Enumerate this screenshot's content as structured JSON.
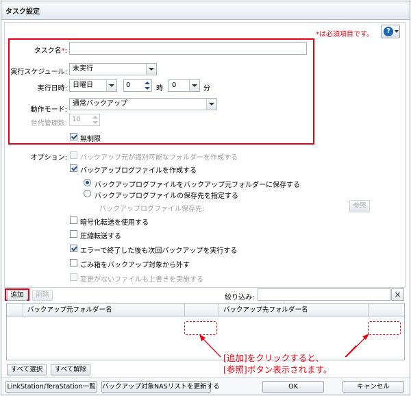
{
  "window": {
    "title": "タスク設定"
  },
  "header": {
    "required_note": "*は必須項目です。",
    "help_glyph": "?"
  },
  "form": {
    "task_name_label": "タスク名",
    "required_mark": "*",
    "colon": ":",
    "task_name_value": "",
    "schedule_label": "実行スケジュール:",
    "schedule_value": "未実行",
    "datetime_label": "実行日時:",
    "day_value": "日曜日",
    "hour_value": "0",
    "hour_unit": "時",
    "minute_value": "0",
    "minute_unit": "分",
    "mode_label": "動作モード:",
    "mode_value": "通常バックアップ",
    "generations_label": "世代管理数:",
    "generations_value": "10",
    "unlimited_label": "無制限"
  },
  "options": {
    "label": "オプション:",
    "identifiable_folder": "バックアップ元が識別可能なフォルダーを作成する",
    "create_log": "バックアップログファイルを作成する",
    "save_log_source": "バックアップログファイルをバックアップ元フォルダーに保存する",
    "specify_log_dest": "バックアップログファイルの保存先を指定する",
    "log_dest_label": "バックアップログファイル保存先:",
    "browse": "参照",
    "encrypt": "暗号化転送を使用する",
    "compress": "圧縮転送する",
    "retry_after_error": "エラーで終了した後も次回バックアップを実行する",
    "exclude_trash": "ごみ箱をバックアップ対象から外す",
    "overwrite_unchanged": "変更がないファイルも上書きを実施する"
  },
  "list": {
    "add": "追加",
    "delete": "削除",
    "filter_label": "絞り込み:",
    "filter_value": "",
    "clear_glyph": "×",
    "col_source": "バックアップ元フォルダー名",
    "col_dest": "バックアップ先フォルダー名",
    "select_all": "すべて選択",
    "deselect_all": "すべて解除"
  },
  "annotation": {
    "line1": "[追加]をクリックすると、",
    "line2": "[参照]ボタン表示されます。"
  },
  "footer": {
    "linkstation_list": "LinkStation/TeraStation一覧",
    "refresh_nas_list": "バックアップ対象NASリストを更新する",
    "ok": "OK",
    "cancel": "キャンセル"
  },
  "colors": {
    "accent_red": "#e60012",
    "brand_blue": "#1a64b4"
  },
  "icons": [
    "help-icon",
    "chevron-down-icon",
    "spinner-icon",
    "checkmark-icon",
    "close-icon",
    "arrow-icon"
  ]
}
